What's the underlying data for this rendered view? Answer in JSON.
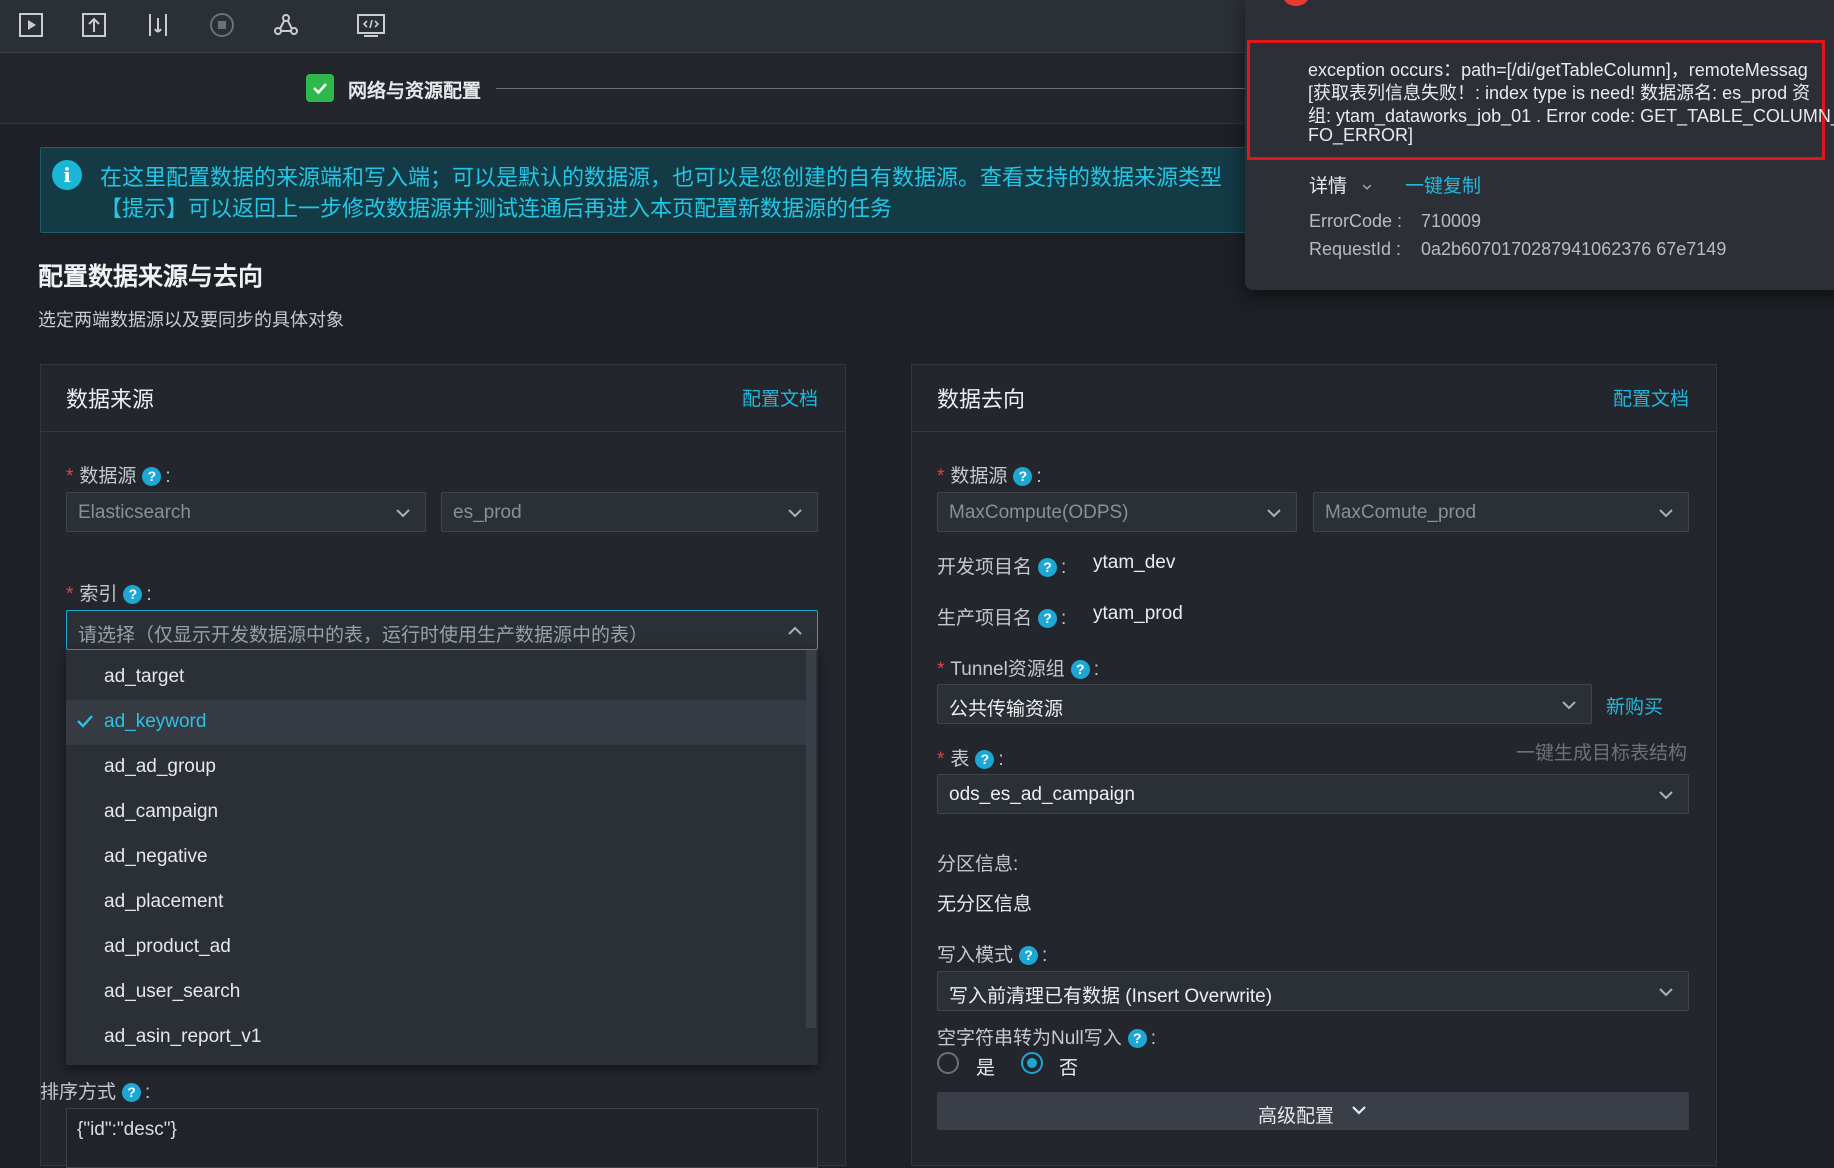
{
  "toolbar": {
    "icons": [
      "run-icon",
      "submit-icon",
      "deploy-icon",
      "stop-icon",
      "lineage-icon",
      "code-view-icon"
    ]
  },
  "step": {
    "label": "网络与资源配置"
  },
  "alert": {
    "line1": "在这里配置数据的来源端和写入端；可以是默认的数据源，也可以是您创建的自有数据源。查看支持的数据来源类型",
    "line2": "【提示】可以返回上一步修改数据源并测试连通后再进入本页配置新数据源的任务"
  },
  "section": {
    "title": "配置数据来源与去向",
    "subtitle": "选定两端数据源以及要同步的具体对象"
  },
  "source": {
    "title": "数据来源",
    "doc_link": "配置文档",
    "datasource_label": "数据源",
    "datasource_type": "Elasticsearch",
    "datasource_name": "es_prod",
    "index_label": "索引",
    "index_placeholder": "请选择（仅显示开发数据源中的表，运行时使用生产数据源中的表）",
    "index_options": [
      "ad_target",
      "ad_keyword",
      "ad_ad_group",
      "ad_campaign",
      "ad_negative",
      "ad_placement",
      "ad_product_ad",
      "ad_user_search",
      "ad_asin_report_v1"
    ],
    "selected_option": "ad_keyword",
    "sort_label": "排序方式",
    "sort_value": "{\"id\":\"desc\"}"
  },
  "target": {
    "title": "数据去向",
    "doc_link": "配置文档",
    "datasource_label": "数据源",
    "datasource_type": "MaxCompute(ODPS)",
    "datasource_name": "MaxComute_prod",
    "dev_project_label": "开发项目名",
    "dev_project_value": "ytam_dev",
    "prod_project_label": "生产项目名",
    "prod_project_value": "ytam_prod",
    "tunnel_label": "Tunnel资源组",
    "tunnel_value": "公共传输资源",
    "buy_link": "新购买",
    "table_label": "表",
    "gen_link": "一键生成目标表结构",
    "table_value": "ods_es_ad_campaign",
    "partition_label": "分区信息",
    "partition_value": "无分区信息",
    "write_mode_label": "写入模式",
    "write_mode_value": "写入前清理已有数据 (Insert Overwrite)",
    "null_label": "空字符串转为Null写入",
    "radio_yes": "是",
    "radio_no": "否",
    "null_selected": "否",
    "advanced_label": "高级配置"
  },
  "error": {
    "lines": [
      "exception occurs：path=[/di/getTableColumn]，remoteMessag",
      "[获取表列信息失败！: index type is need! 数据源名: es_prod 资",
      "组: ytam_dataworks_job_01 . Error code: GET_TABLE_COLUMN_",
      "FO_ERROR]"
    ],
    "details_label": "详情",
    "copy_label": "一键复制",
    "error_code_label": "ErrorCode :",
    "error_code": "710009",
    "request_id_label": "RequestId :",
    "request_id": "0a2b6070170287941062376 67e7149"
  },
  "colors": {
    "accent": "#24b8dd",
    "required": "#e0443c",
    "success": "#2fb84b",
    "error_border": "#e0161b"
  }
}
